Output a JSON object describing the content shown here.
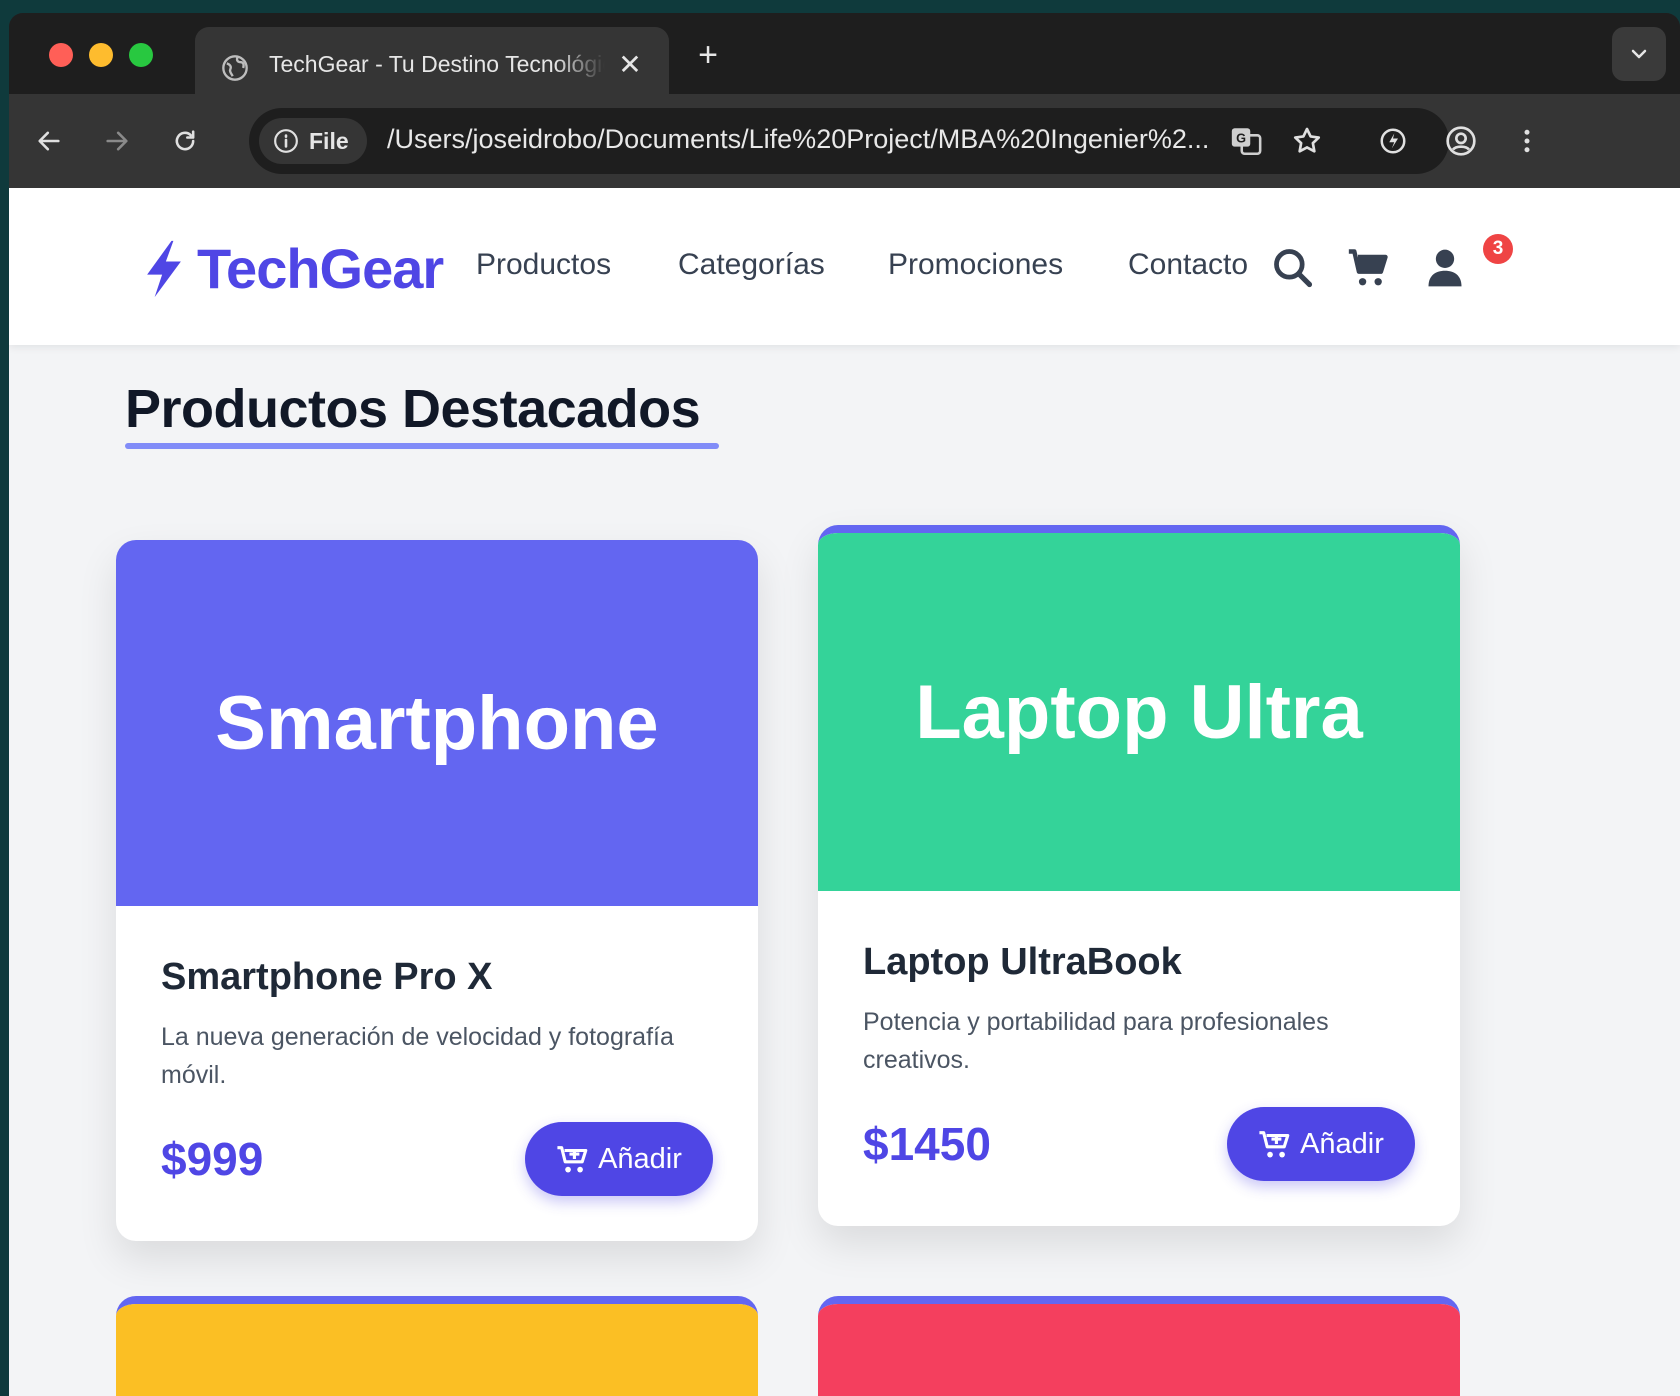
{
  "browser": {
    "tab_title": "TechGear - Tu Destino Tecnológico",
    "new_tab_icon": "plus-icon",
    "address_chip": "File",
    "url": "/Users/joseidrobo/Documents/Life%20Project/MBA%20Ingenier%2..."
  },
  "site": {
    "brand": "TechGear",
    "nav": [
      "Productos",
      "Categorías",
      "Promociones",
      "Contacto"
    ],
    "cart_count": "3",
    "colors": {
      "brand": "#4f46e5",
      "badge": "#ef4444",
      "underline": "#818cf8"
    }
  },
  "section": {
    "title": "Productos Destacados"
  },
  "products": [
    {
      "image_label": "Smartphone",
      "image_color": "#6366f1",
      "name": "Smartphone Pro X",
      "description": "La nueva generación de velocidad y fotografía móvil.",
      "price": "$999",
      "button": "Añadir"
    },
    {
      "image_label": "Laptop Ultra",
      "image_color": "#34d399",
      "name": "Laptop UltraBook",
      "description": "Potencia y portabilidad para profesionales creativos.",
      "price": "$1450",
      "button": "Añadir"
    }
  ]
}
